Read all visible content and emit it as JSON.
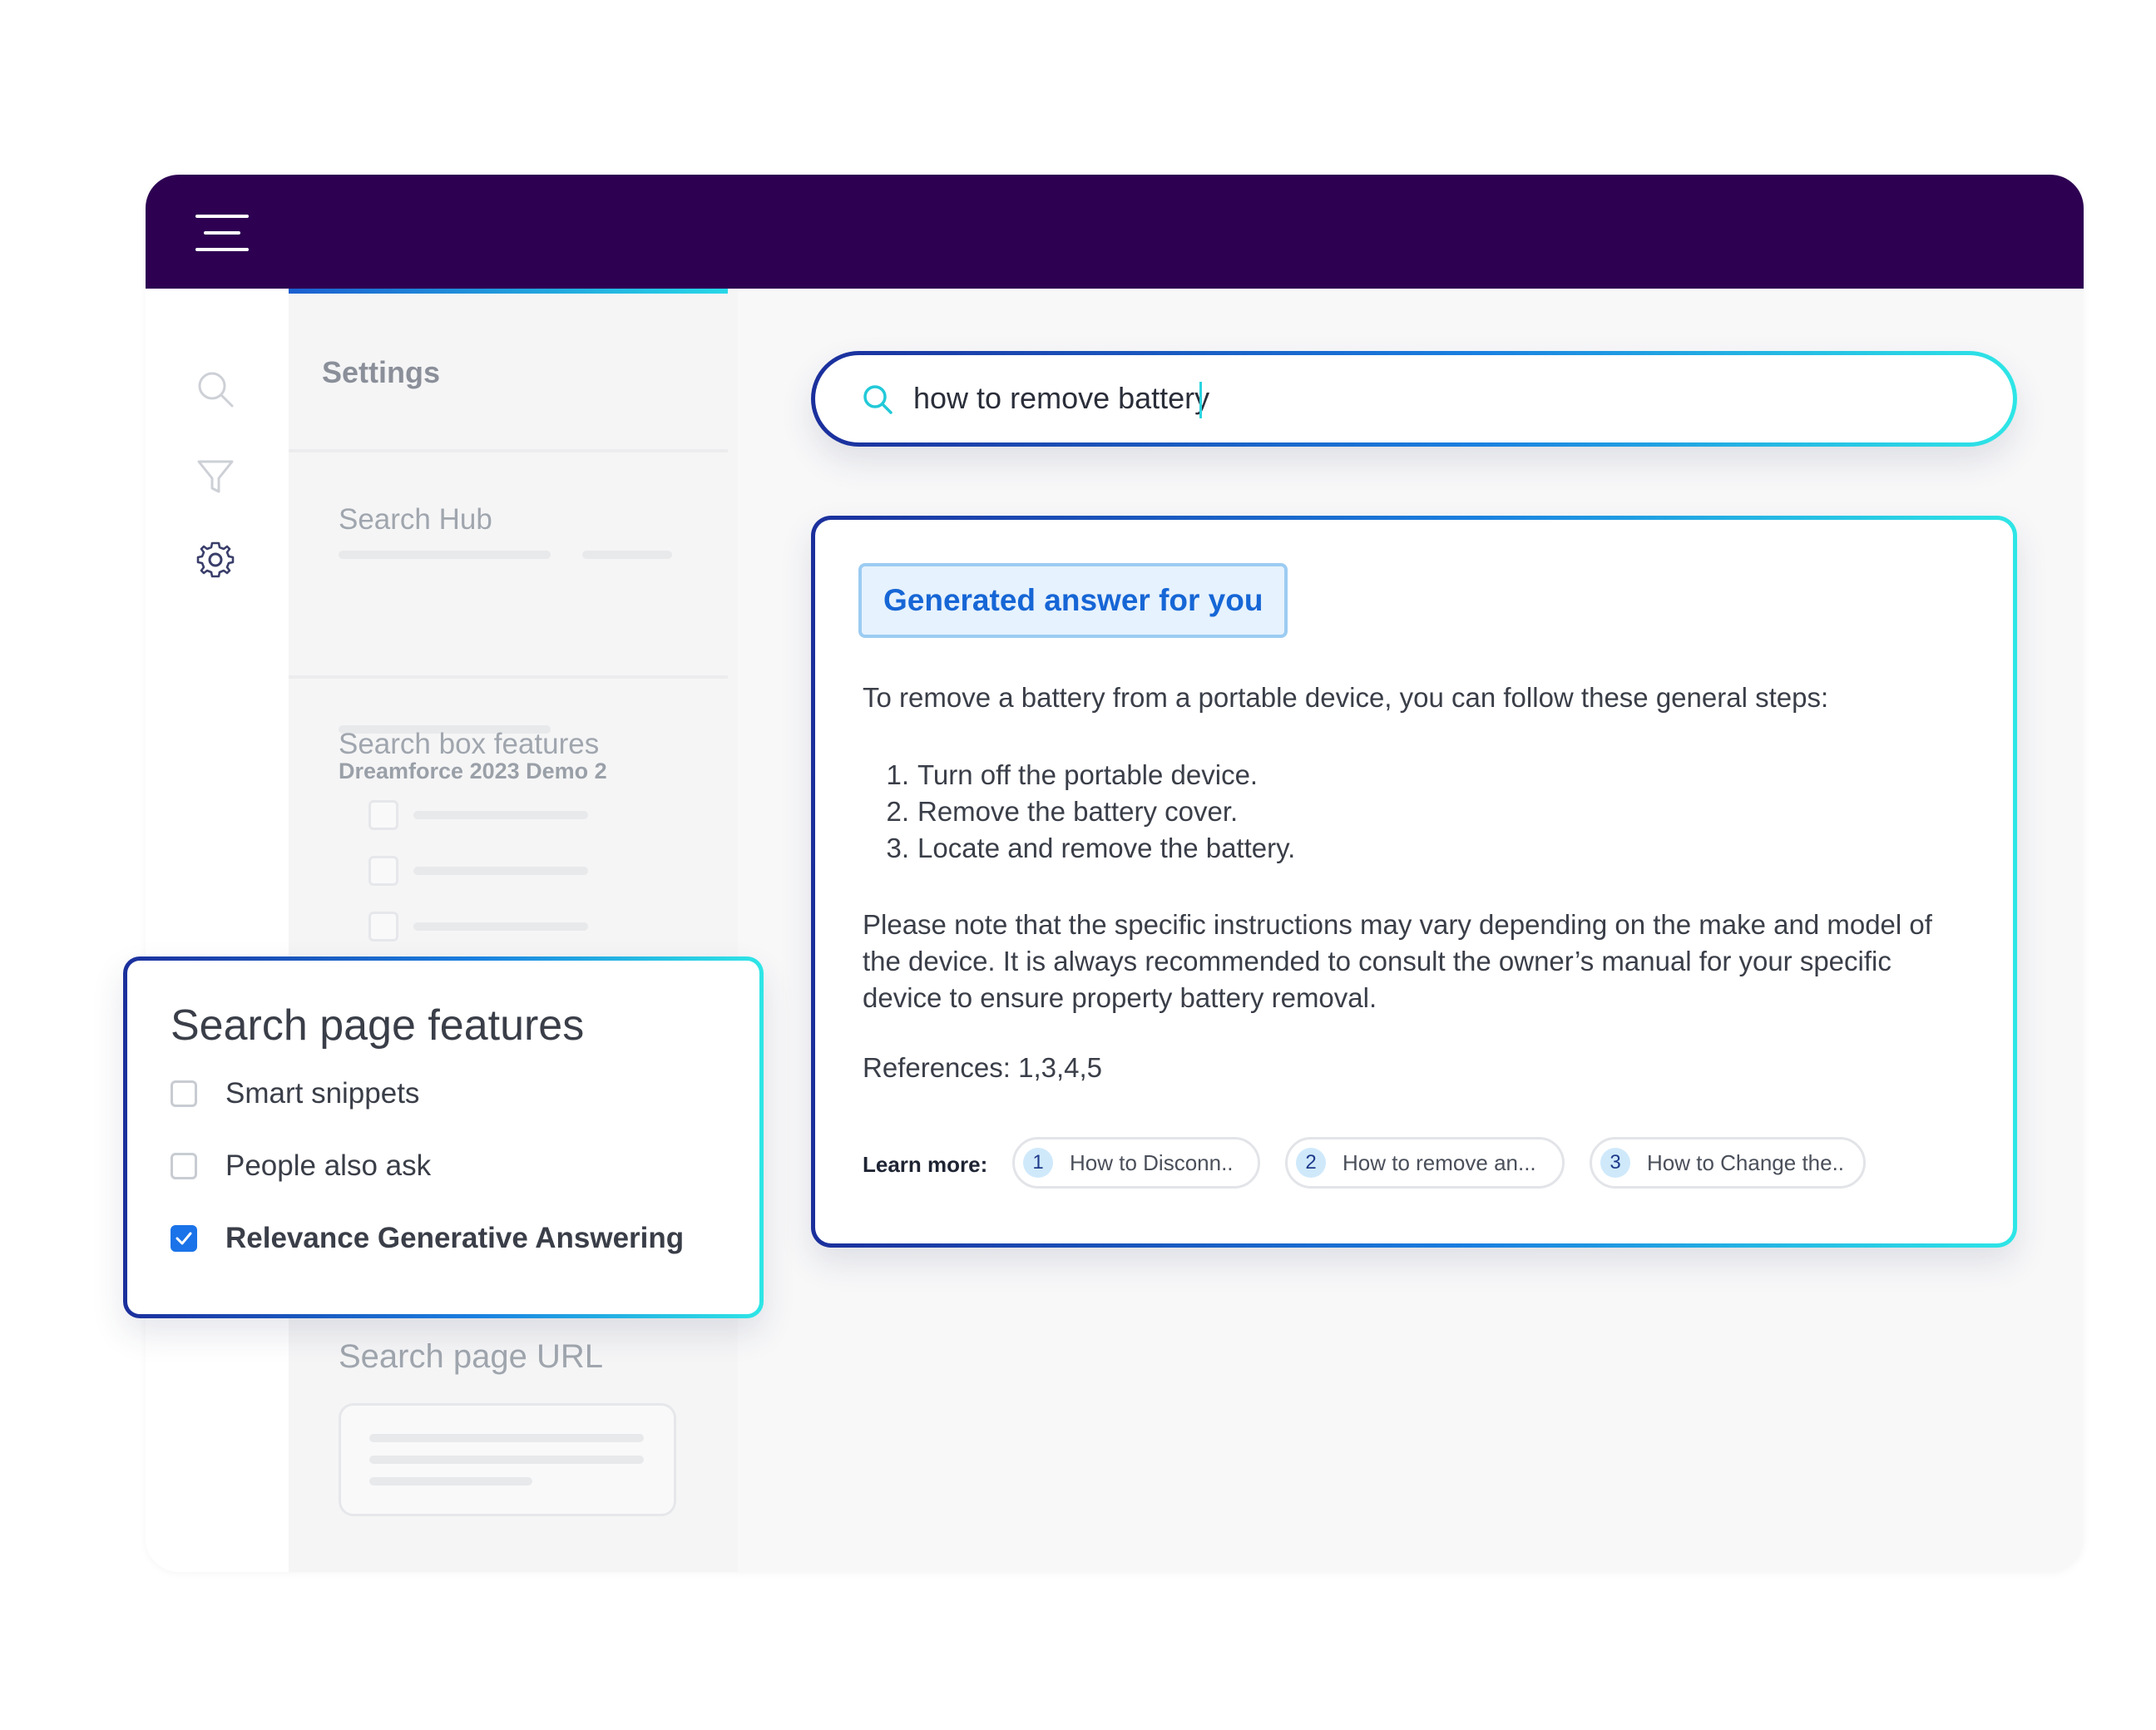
{
  "sidebar": {
    "settings_title": "Settings",
    "search_hub_label": "Search Hub",
    "search_hub_value": "Dreamforce 2023 Demo 2",
    "search_box_features_label": "Search box features",
    "search_page_url_label": "Search page URL",
    "rail_icons": [
      "search-icon",
      "filter-icon",
      "gear-icon"
    ]
  },
  "search": {
    "query": "how to remove battery"
  },
  "answer": {
    "label": "Generated answer for you",
    "intro": "To remove a battery from a portable device, you can follow these general steps:",
    "steps": [
      {
        "num": "1.",
        "text": "Turn off the portable device."
      },
      {
        "num": "2.",
        "text": "Remove the battery cover."
      },
      {
        "num": "3.",
        "text": "Locate and remove the battery."
      }
    ],
    "note": "Please note that the specific instructions may vary depending on the make and model of the device. It is always recommended to consult the owner’s manual for your specific device to ensure property battery removal.",
    "references": "References: 1,3,4,5",
    "learn_more_label": "Learn more:",
    "chips": [
      {
        "num": "1",
        "text": "How to Disconn.."
      },
      {
        "num": "2",
        "text": "How to remove an..."
      },
      {
        "num": "3",
        "text": "How to Change the.."
      }
    ]
  },
  "features": {
    "title": "Search page features",
    "items": [
      {
        "label": "Smart snippets",
        "checked": false
      },
      {
        "label": "People also ask",
        "checked": false
      },
      {
        "label": "Relevance Generative Answering",
        "checked": true
      }
    ]
  },
  "colors": {
    "topbar": "#2d0052",
    "accent_blue": "#1a73e8",
    "gradient_start": "#1b2f9c",
    "gradient_end": "#2ee6e6"
  }
}
